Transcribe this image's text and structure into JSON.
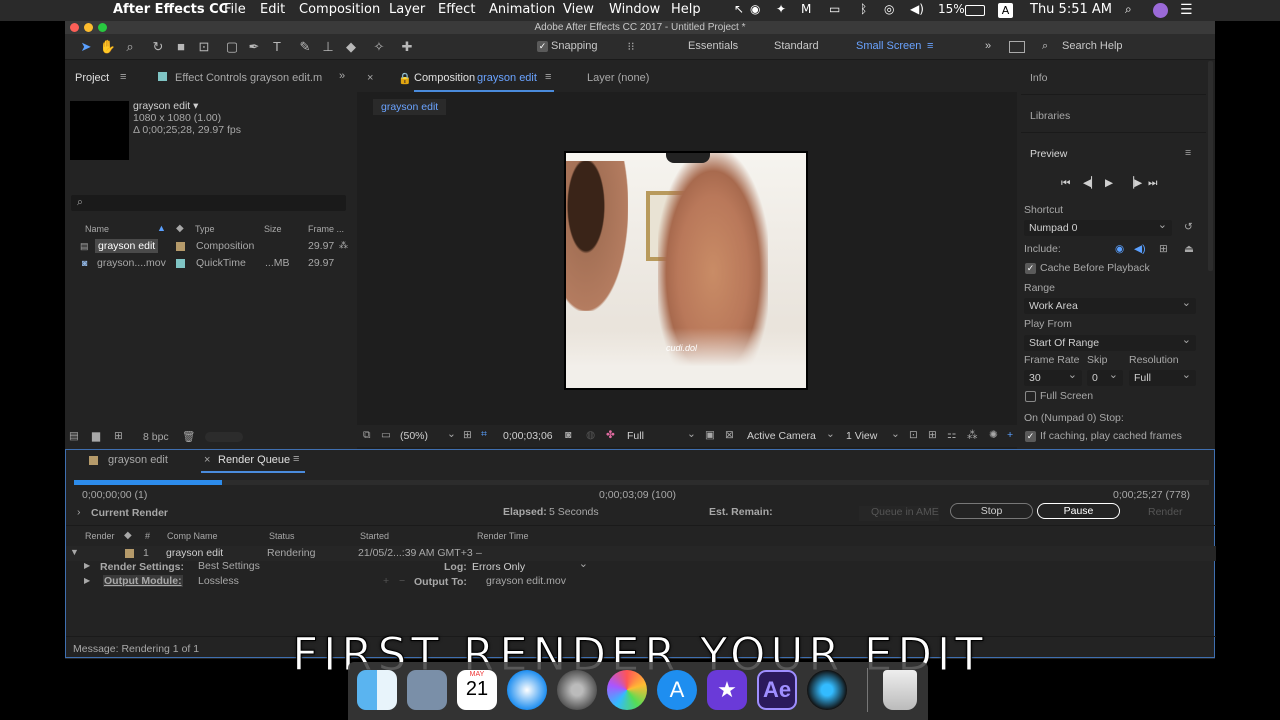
{
  "menubar": {
    "app_name": "After Effects CC",
    "items": [
      "File",
      "Edit",
      "Composition",
      "Layer",
      "Effect",
      "Animation",
      "View",
      "Window",
      "Help"
    ],
    "battery": "15%",
    "input_source": "A",
    "clock": "Thu 5:51 AM"
  },
  "window": {
    "title": "Adobe After Effects CC 2017 - Untitled Project *"
  },
  "toolbar": {
    "snapping_label": "Snapping",
    "workspaces": [
      "Essentials",
      "Standard",
      "Small Screen"
    ],
    "active_workspace": "Small Screen",
    "search_placeholder": "Search Help"
  },
  "project_panel": {
    "tab_project": "Project",
    "tab_effect_controls": "Effect Controls grayson edit.m",
    "preview_name": "grayson edit ▾",
    "preview_dims": "1080 x 1080 (1.00)",
    "preview_duration": "Δ 0;00;25;28, 29.97 fps",
    "columns": [
      "Name",
      "Type",
      "Size",
      "Frame ..."
    ],
    "rows": [
      {
        "name": "grayson edit",
        "type": "Composition",
        "size": "",
        "frame": "29.97",
        "color": "#b59a6a"
      },
      {
        "name": "grayson....mov",
        "type": "QuickTime",
        "size": "...MB",
        "frame": "29.97",
        "color": "#7fc4c4"
      }
    ],
    "bpc": "8 bpc"
  },
  "comp_panel": {
    "tab_label_prefix": "Composition",
    "tab_comp_name": "grayson edit",
    "tab_layer": "Layer (none)",
    "breadcrumb": "grayson edit",
    "watermark": "cudi.dol",
    "zoom": "(50%)",
    "timecode": "0;00;03;06",
    "resolution": "Full",
    "camera": "Active Camera",
    "view": "1 View"
  },
  "right_panel": {
    "info": "Info",
    "libraries": "Libraries",
    "preview": "Preview",
    "shortcut_label": "Shortcut",
    "shortcut_value": "Numpad 0",
    "include_label": "Include:",
    "cache_before_playback": "Cache Before Playback",
    "range_label": "Range",
    "range_value": "Work Area",
    "play_from_label": "Play From",
    "play_from_value": "Start Of Range",
    "frame_rate_label": "Frame Rate",
    "skip_label": "Skip",
    "resolution_label": "Resolution",
    "frame_rate_value": "30",
    "skip_value": "0",
    "resolution_value": "Full",
    "full_screen": "Full Screen",
    "on_stop_label": "On (Numpad 0) Stop:",
    "if_caching": "If caching, play cached frames"
  },
  "render_queue": {
    "tab_comp": "grayson edit",
    "tab_rq": "Render Queue",
    "start_time": "0;00;00;00 (1)",
    "current_time": "0;00;03;09 (100)",
    "end_time": "0;00;25;27 (778)",
    "progress_percent": 13,
    "current_render_label": "Current Render",
    "elapsed_label": "Elapsed:",
    "elapsed_value": "5 Seconds",
    "est_remain_label": "Est. Remain:",
    "queue_in_ame": "Queue in AME",
    "stop": "Stop",
    "pause": "Pause",
    "render": "Render",
    "columns": [
      "Render",
      "#",
      "Comp Name",
      "Status",
      "Started",
      "Render Time"
    ],
    "item": {
      "number": "1",
      "comp_name": "grayson edit",
      "status": "Rendering",
      "started": "21/05/2...:39 AM GMT+3",
      "render_time": "–"
    },
    "render_settings_label": "Render Settings:",
    "render_settings_value": "Best Settings",
    "log_label": "Log:",
    "log_value": "Errors Only",
    "output_module_label": "Output Module:",
    "output_module_value": "Lossless",
    "output_to_label": "Output To:",
    "output_to_value": "grayson edit.mov",
    "message": "Message: Rendering 1 of 1"
  },
  "caption": "FIRST RENDER YOUR EDIT",
  "dock": {
    "calendar_month": "MAY",
    "calendar_day": "21",
    "ae_label": "Ae"
  },
  "colors": {
    "accent_blue": "#2d8ceb",
    "ae_purple": "#2b1a5c"
  }
}
